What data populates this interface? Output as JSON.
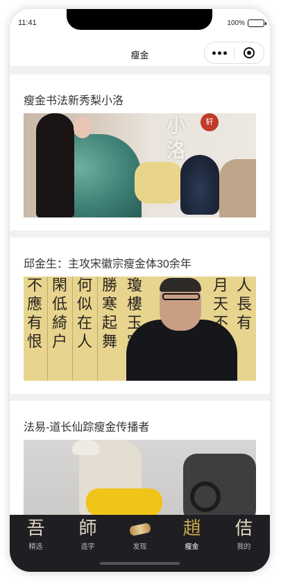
{
  "status": {
    "time": "11:41",
    "battery": "100%"
  },
  "nav": {
    "title": "瘦金"
  },
  "feed": [
    {
      "title": "瘦金书法新秀梨小洛",
      "image_text": "小洛",
      "seal": "轩"
    },
    {
      "title": "邱金生：主攻宋徽宗瘦金体30余年",
      "image_columns": [
        "不應有恨",
        "閑低綺户",
        "何似在人",
        "勝寒起舞",
        "瓊樓玉宇",
        "月天不",
        "人長有"
      ]
    },
    {
      "title": "法易-道长仙踪瘦金传播者"
    }
  ],
  "tabbar": [
    {
      "glyph": "吾",
      "label": "精选",
      "active": false
    },
    {
      "glyph": "師",
      "label": "造字",
      "active": false
    },
    {
      "glyph": "",
      "label": "发现",
      "active": false
    },
    {
      "glyph": "趙",
      "label": "瘦金",
      "active": true
    },
    {
      "glyph": "佶",
      "label": "我的",
      "active": false
    }
  ]
}
